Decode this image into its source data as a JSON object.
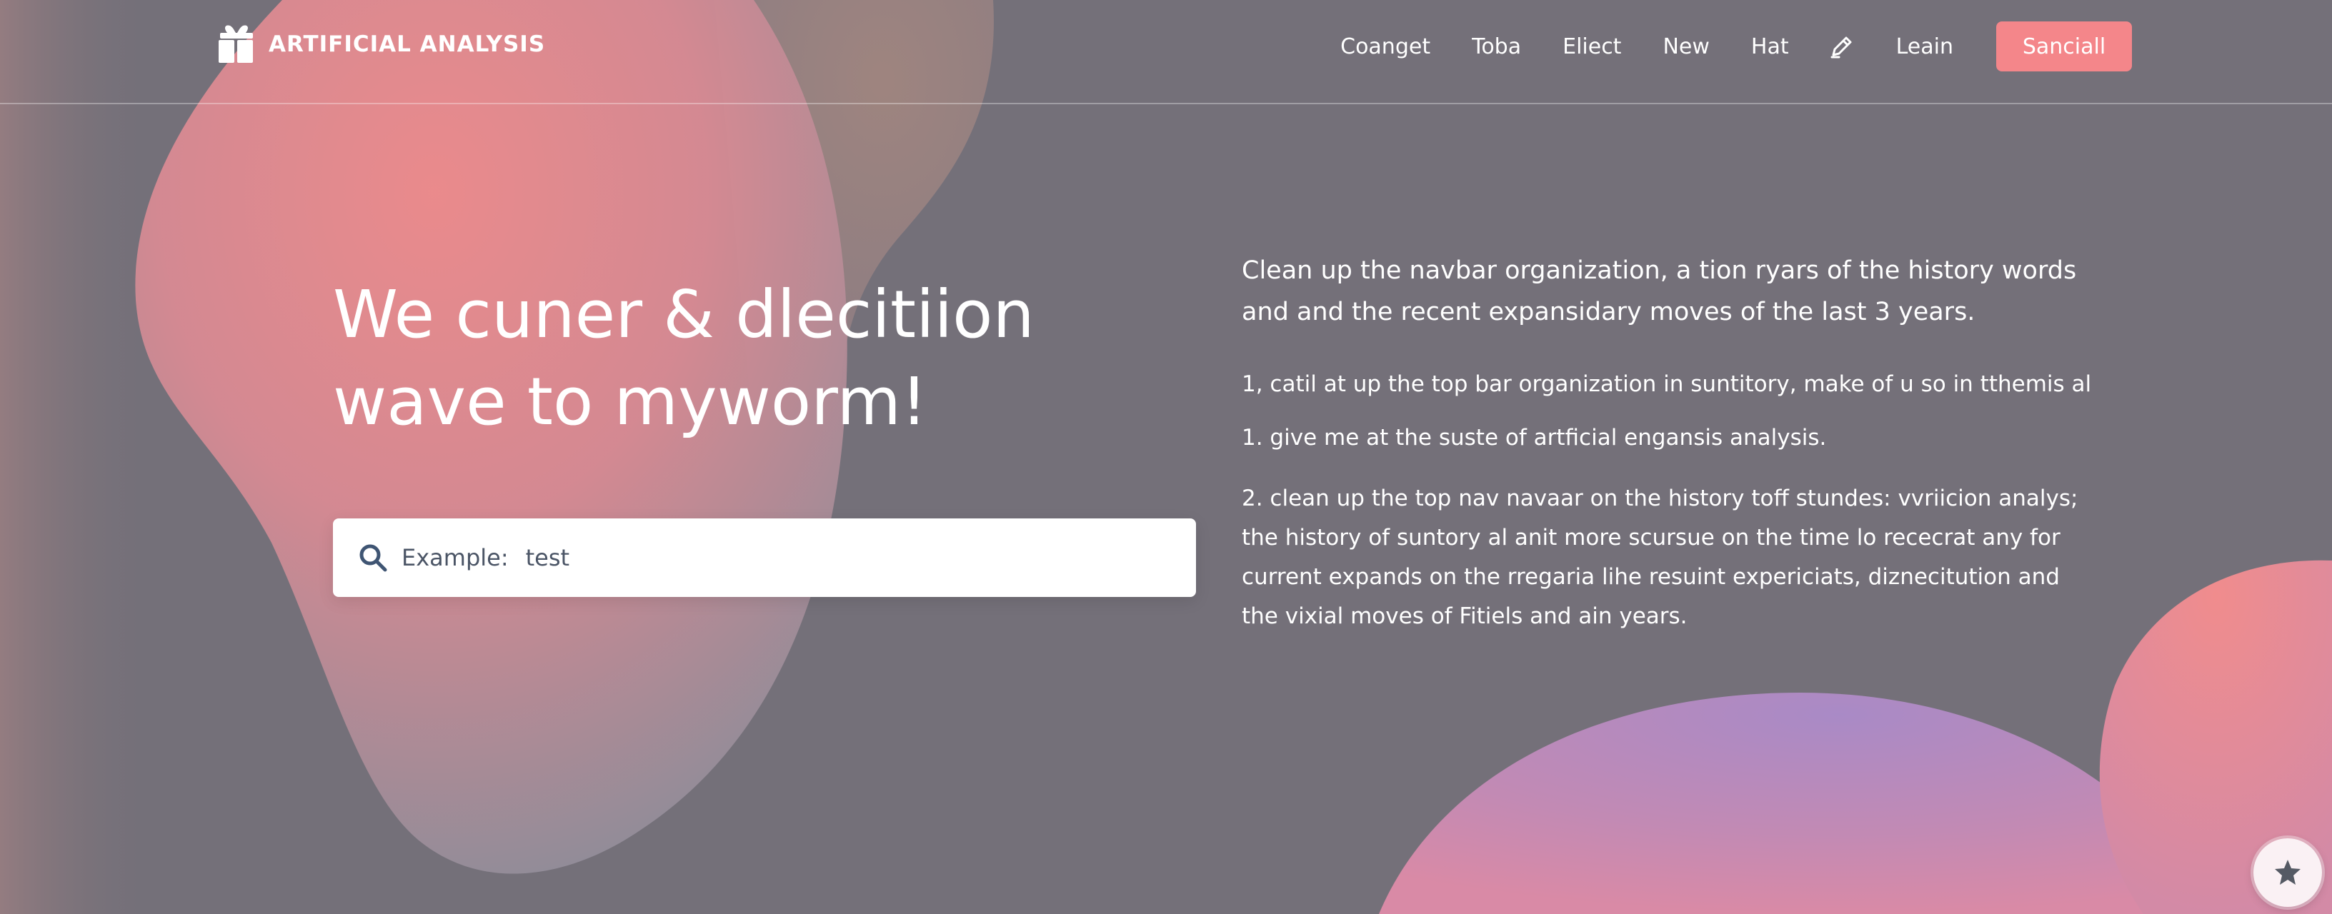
{
  "brand": {
    "name": "ARTIFICIAL ANALYSIS",
    "logo_icon": "gift-icon"
  },
  "nav": {
    "items": [
      "Coanget",
      "Toba",
      "Eliect",
      "New",
      "Hat"
    ],
    "edit_icon": "pen-icon",
    "login_label": "Leain",
    "cta_label": "Sanciall"
  },
  "hero": {
    "title_line1": "We cuner & dlecitiion",
    "title_line2": "wave to myworm!"
  },
  "search": {
    "label": "Example:",
    "value": "test",
    "icon": "search-icon"
  },
  "content": {
    "lead": "Clean up the navbar organization, a tion ryars of the history words and and the recent expansidary moves of the last 3 years.",
    "points": [
      "1, catil at up the top bar organization in suntitory, make of u so in tthemis al",
      "1. give me at the suste of artficial engansis analysis.",
      "2. clean up the top nav navaar on the history toff stundes: vvriicion analys; the history of suntory al anit more scursue on the time lo rececrat any for current expands on the rregaria lihe resuint expericiats, diznecitution and the vixial moves of Fitiels and ain years."
    ]
  },
  "floating_button": {
    "icon": "star-icon"
  },
  "colors": {
    "background": "#747079",
    "accent": "#f4868a",
    "blob_pink": "#f08c8d",
    "blob_purple": "#a888c4",
    "input_text": "#4b5566"
  }
}
